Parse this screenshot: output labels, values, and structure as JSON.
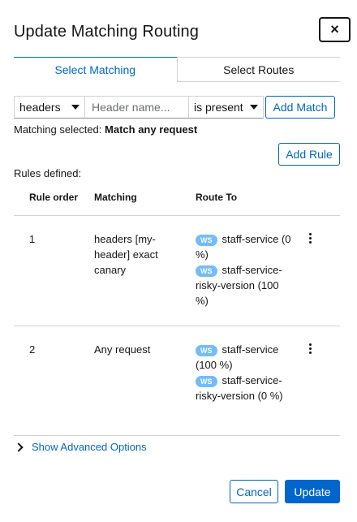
{
  "modal": {
    "title": "Update Matching Routing",
    "close_label": "×"
  },
  "tabs": [
    {
      "label": "Select Matching",
      "active": true
    },
    {
      "label": "Select Routes",
      "active": false
    }
  ],
  "filter": {
    "type_value": "headers",
    "header_placeholder": "Header name...",
    "condition_value": "is present",
    "add_match_label": "Add Match"
  },
  "matching_selected": {
    "prefix": "Matching selected:",
    "value": "Match any request"
  },
  "add_rule_label": "Add Rule",
  "rules_defined_label": "Rules defined:",
  "table": {
    "columns": [
      "Rule order",
      "Matching",
      "Route To"
    ],
    "rows": [
      {
        "order": "1",
        "matching": "headers [my-header] exact canary",
        "routes": [
          {
            "badge": "WS",
            "text": "staff-service (0 %)"
          },
          {
            "badge": "WS",
            "text": "staff-service-risky-version (100 %)"
          }
        ]
      },
      {
        "order": "2",
        "matching": "Any request",
        "routes": [
          {
            "badge": "WS",
            "text": "staff-service (100 %)"
          },
          {
            "badge": "WS",
            "text": "staff-service-risky-version (0 %)"
          }
        ]
      }
    ]
  },
  "advanced_label": "Show Advanced Options",
  "footer": {
    "cancel_label": "Cancel",
    "update_label": "Update"
  },
  "colors": {
    "accent": "#0066cc",
    "badge": "#73bcf7",
    "border": "#d2d2d2"
  }
}
